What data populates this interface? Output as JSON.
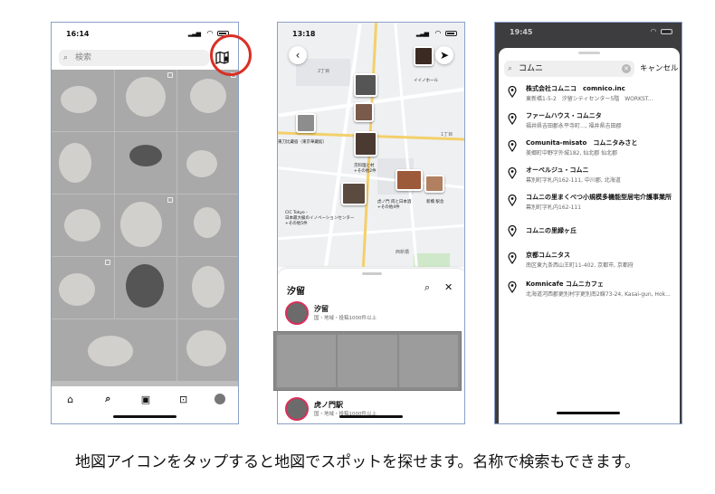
{
  "phone1": {
    "time": "16:14",
    "search_placeholder": "検索",
    "tabs": [
      "home-icon",
      "search-icon",
      "reels-icon",
      "shop-icon",
      "profile-avatar"
    ]
  },
  "phone2": {
    "time": "13:18",
    "map_labels": {
      "itte": "イイノホール",
      "museum": "東刀比藏宿（東京華藏館）",
      "kyobashi": "京料理と村\n+その他2件",
      "toranomon": "虎ノ門 肉と日本酒\n+その他4件",
      "shinbashi": "新橋 駅舎",
      "cic": "CIC Tokyo -\n日本最大級のイノベーションセンター\n+その他5件",
      "nishi": "西新橋",
      "c2": "2丁目",
      "c1": "1丁目"
    },
    "sheet_title": "汐留",
    "places": [
      {
        "name": "汐留",
        "meta": "国・地域・投稿1000件以上"
      },
      {
        "name": "虎ノ門駅",
        "meta": "国・地域・投稿1000件以上"
      }
    ]
  },
  "phone3": {
    "time": "19:45",
    "search_value": "コムニ",
    "cancel": "キャンセル",
    "results": [
      {
        "name": "株式会社コムニコ　comnico.inc",
        "addr": "東新橋1-5-2　汐留シティセンター5階　WORKST..."
      },
      {
        "name": "ファームハウス・コムニタ",
        "addr": "福井県吉田郡永平寺町..., 福井県吉田郡"
      },
      {
        "name": "Comunita-misato　コムニタみさと",
        "addr": "美郷町中野字外城182, 仙北郡 仙北郡"
      },
      {
        "name": "オーベルジュ・コムニ",
        "addr": "幕別町字札内162-111, 中川郡, 北海道"
      },
      {
        "name": "コムニの里まくべつ小規模多機能型居宅介護事業所",
        "addr": "幕別町字札内162-111"
      },
      {
        "name": "コムニの里緑ヶ丘",
        "addr": ""
      },
      {
        "name": "京都コムニタス",
        "addr": "南区東九条西山王町11-402, 京都市, 京都府"
      },
      {
        "name": "Komnicafe コムニカフェ",
        "addr": "北海道河西郡更別村字更別南2線73-24, Kasai-gun, Hok..."
      }
    ]
  },
  "caption": "地図アイコンをタップすると地図でスポットを探せます。名称で検索もできます。"
}
